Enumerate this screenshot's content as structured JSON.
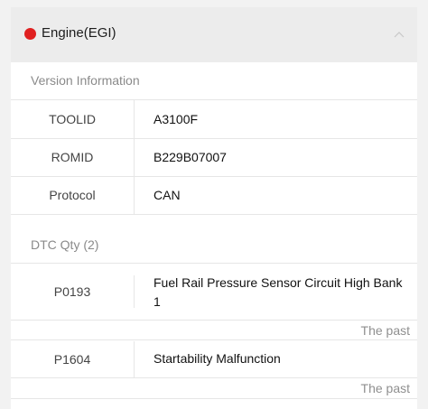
{
  "header": {
    "title": "Engine(EGI)",
    "status_color": "#e02020",
    "chevron_icon": "chevron-up-icon"
  },
  "version_info": {
    "section_label": "Version Information",
    "rows": [
      {
        "key": "TOOLID",
        "value": "A3100F"
      },
      {
        "key": "ROMID",
        "value": "B229B07007"
      },
      {
        "key": "Protocol",
        "value": "CAN"
      }
    ]
  },
  "dtc": {
    "section_label": "DTC Qty (2)",
    "items": [
      {
        "code": "P0193",
        "description": "Fuel Rail Pressure Sensor Circuit High Bank 1",
        "status": "The past"
      },
      {
        "code": "P1604",
        "description": "Startability Malfunction",
        "status": "The past"
      }
    ]
  }
}
